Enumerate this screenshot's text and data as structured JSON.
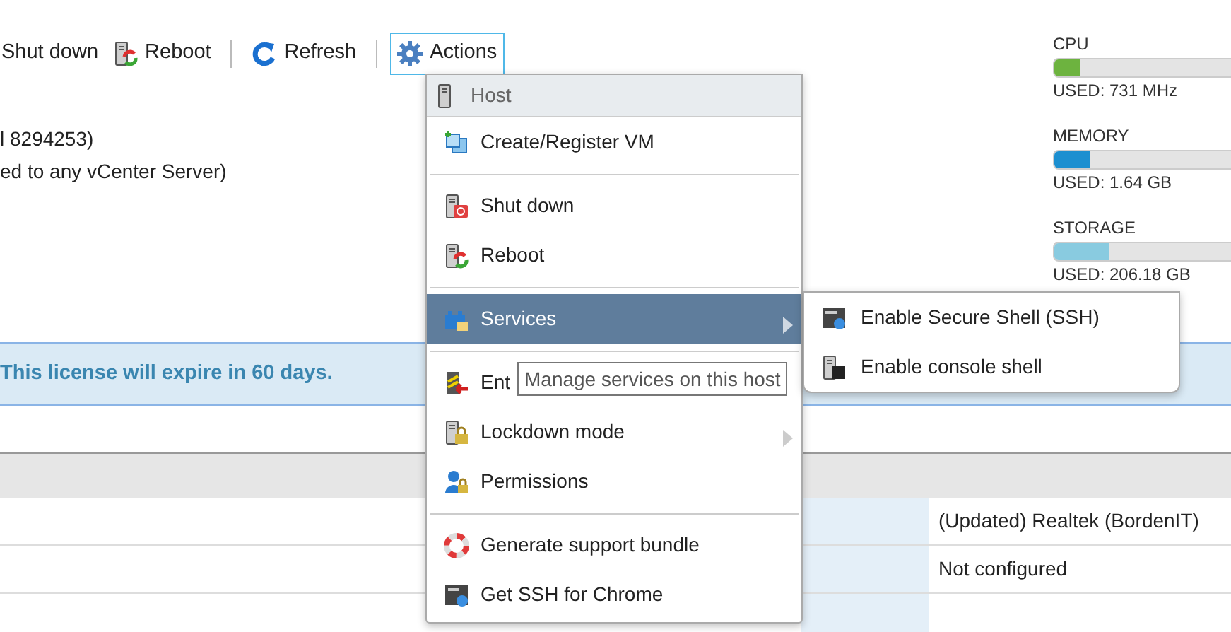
{
  "toolbar": [
    {
      "label": "Shut down",
      "kind": "plain",
      "selected": false
    },
    {
      "label": "Reboot",
      "kind": "reboot",
      "selected": false
    },
    {
      "kind": "separator"
    },
    {
      "label": "Refresh",
      "kind": "refresh",
      "selected": false
    },
    {
      "kind": "separator"
    },
    {
      "label": "Actions",
      "kind": "gear",
      "selected": true
    }
  ],
  "host_info": [
    "l 8294253)",
    "ed to any vCenter Server)"
  ],
  "resources": [
    {
      "label": "CPU",
      "level": 0.14,
      "reading": "USED: 731 MHz",
      "color": "#6db33f"
    },
    {
      "label": "MEMORY",
      "level": 0.2,
      "reading": "USED: 1.64 GB",
      "color": "#1c8fd0"
    },
    {
      "label": "STORAGE",
      "level": 0.31,
      "reading": "USED: 206.18 GB",
      "color": "#89cbe0"
    }
  ],
  "license_banner": "This license will expire in 60 days.",
  "table": {
    "rows": [
      {
        "value": "(Updated) Realtek (BordenIT)"
      },
      {
        "value": "Not configured"
      }
    ]
  },
  "actions_menu": [
    {
      "kind": "header",
      "label": "Host"
    },
    {
      "kind": "item",
      "label": "Create/Register VM",
      "selected": false,
      "has_submenu": false
    },
    {
      "kind": "separator"
    },
    {
      "kind": "item",
      "label": "Shut down",
      "selected": false,
      "has_submenu": false
    },
    {
      "kind": "item",
      "label": "Reboot",
      "selected": false,
      "has_submenu": false
    },
    {
      "kind": "separator"
    },
    {
      "kind": "item",
      "label": "Services",
      "selected": true,
      "has_submenu": true
    },
    {
      "kind": "separator"
    },
    {
      "kind": "item",
      "label": "Ent",
      "selected": false,
      "has_submenu": false
    },
    {
      "kind": "item",
      "label": "Lockdown mode",
      "selected": false,
      "has_submenu": true
    },
    {
      "kind": "item",
      "label": "Permissions",
      "selected": false,
      "has_submenu": false
    },
    {
      "kind": "separator"
    },
    {
      "kind": "item",
      "label": "Generate support bundle",
      "selected": false,
      "has_submenu": false
    },
    {
      "kind": "item",
      "label": "Get SSH for Chrome",
      "selected": false,
      "has_submenu": false
    }
  ],
  "services_submenu": [
    {
      "label": "Enable Secure Shell (SSH)"
    },
    {
      "label": "Enable console shell"
    }
  ],
  "tooltip": "Manage services on this host"
}
